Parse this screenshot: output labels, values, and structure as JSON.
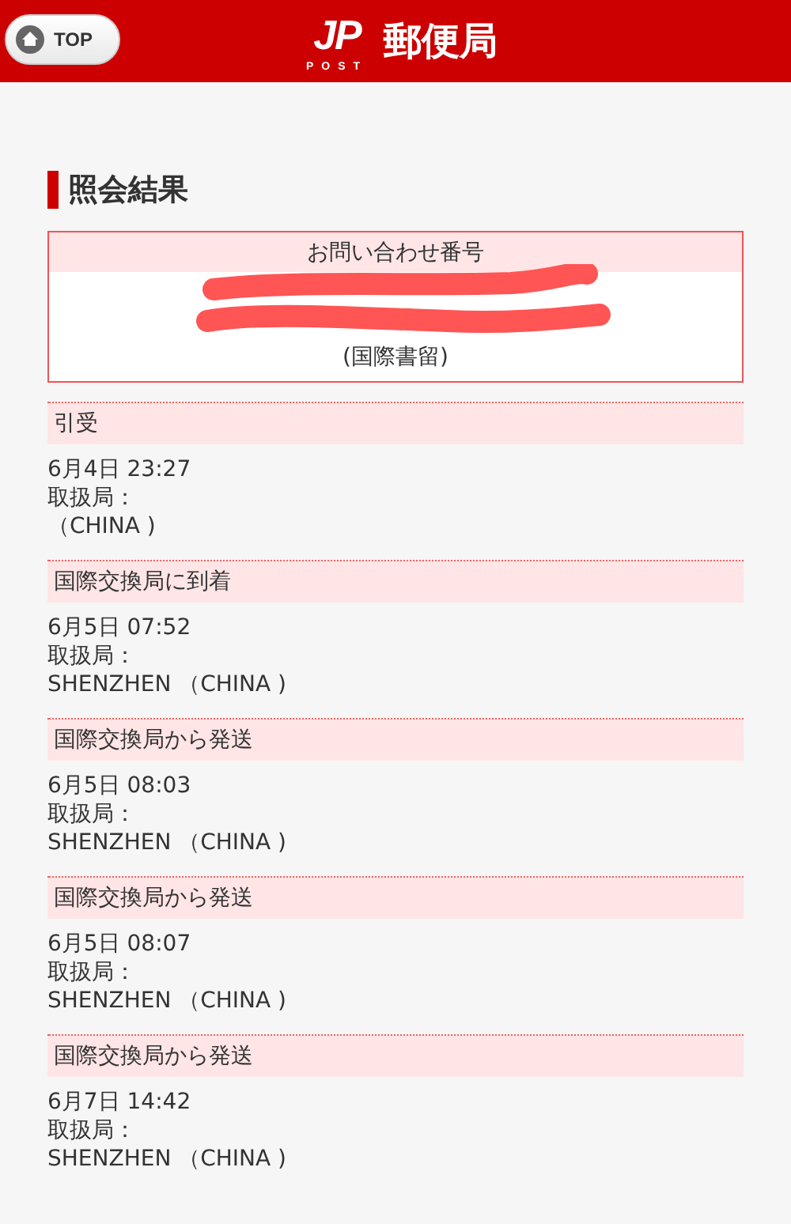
{
  "header": {
    "top_button": "TOP",
    "logo": {
      "mark": "JP",
      "sub": "POST"
    },
    "title": "郵便局"
  },
  "heading": "照会結果",
  "inquiry": {
    "label": "お問い合わせ番号",
    "type": "(国際書留)"
  },
  "events": [
    {
      "status": "引受",
      "datetime": "6月4日 23:27",
      "office_label": "取扱局：",
      "office": "（CHINA )"
    },
    {
      "status": "国際交換局に到着",
      "datetime": "6月5日 07:52",
      "office_label": "取扱局：",
      "office": "SHENZHEN （CHINA )"
    },
    {
      "status": "国際交換局から発送",
      "datetime": "6月5日 08:03",
      "office_label": "取扱局：",
      "office": "SHENZHEN （CHINA )"
    },
    {
      "status": "国際交換局から発送",
      "datetime": "6月5日 08:07",
      "office_label": "取扱局：",
      "office": "SHENZHEN （CHINA )"
    },
    {
      "status": "国際交換局から発送",
      "datetime": "6月7日 14:42",
      "office_label": "取扱局：",
      "office": "SHENZHEN （CHINA )"
    }
  ]
}
